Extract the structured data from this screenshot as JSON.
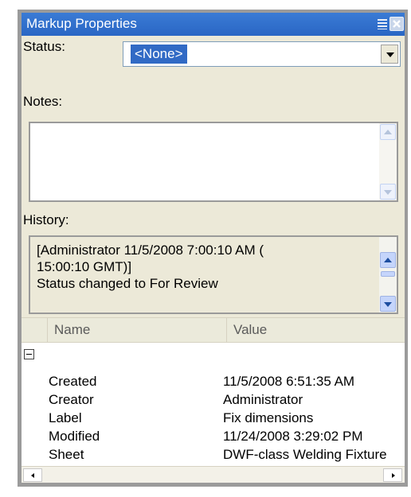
{
  "panel": {
    "title": "Markup Properties"
  },
  "status": {
    "label": "Status:",
    "value": "<None>"
  },
  "notes": {
    "label": "Notes:",
    "value": ""
  },
  "history": {
    "label": "History:",
    "text": "[Administrator 11/5/2008 7:00:10 AM ( 15:00:10 GMT)]\nStatus changed to For Review"
  },
  "grid": {
    "columns": [
      "Name",
      "Value"
    ],
    "rows": [
      {
        "name": "Created",
        "value": "11/5/2008  6:51:35 AM"
      },
      {
        "name": "Creator",
        "value": "Administrator"
      },
      {
        "name": "Label",
        "value": "Fix dimensions"
      },
      {
        "name": "Modified",
        "value": "11/24/2008  3:29:02 PM"
      },
      {
        "name": "Sheet",
        "value": "DWF-class Welding Fixture"
      }
    ]
  },
  "icons": {
    "menu": "list-menu-icon",
    "close": "close-icon",
    "dropdown": "dropdown-arrow-icon",
    "collapse": "collapse-minus-icon"
  },
  "colors": {
    "titlebar": "#3a7bd5",
    "selection": "#316ac5",
    "panel_bg": "#ece9d8"
  }
}
